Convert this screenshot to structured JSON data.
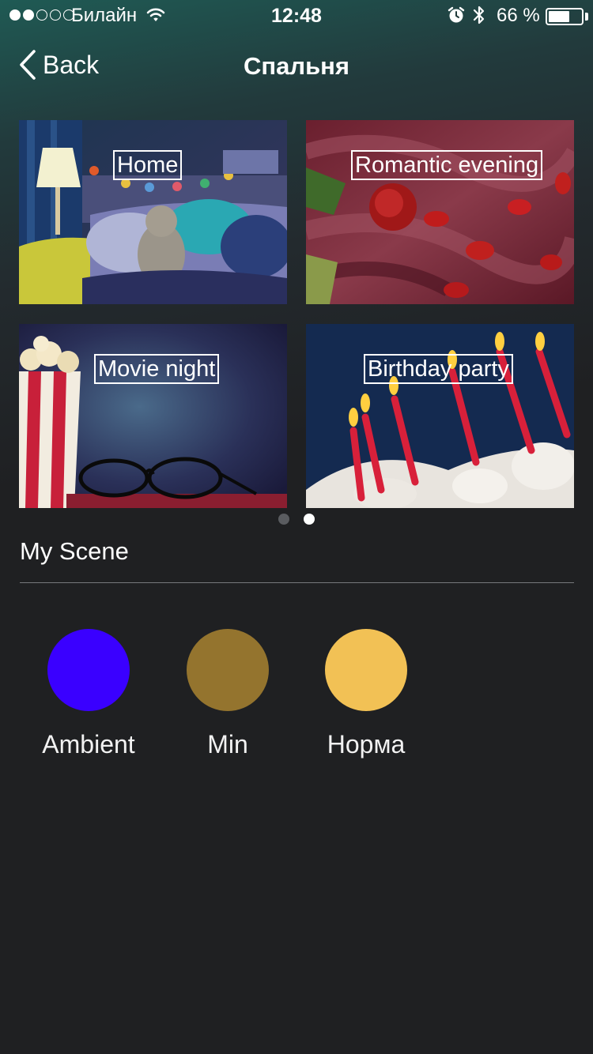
{
  "status_bar": {
    "carrier": "Билайн",
    "time": "12:48",
    "battery_percent": "66 %",
    "battery_level": 0.66,
    "signal_bars_filled": 2,
    "signal_bars_total": 5
  },
  "nav": {
    "back_label": "Back",
    "title": "Спальня"
  },
  "tiles": [
    {
      "label": "Home",
      "image": "kids-bedroom-photo"
    },
    {
      "label": "Romantic evening",
      "image": "rose-petals-silk-photo"
    },
    {
      "label": "Movie night",
      "image": "popcorn-glasses-photo"
    },
    {
      "label": "Birthday party",
      "image": "birthday-candles-photo"
    }
  ],
  "pager": {
    "pages": 2,
    "active_index": 1
  },
  "my_scene": {
    "title": "My Scene",
    "scenes": [
      {
        "label": "Ambient",
        "color": "#3a00ff"
      },
      {
        "label": "Min",
        "color": "#94742e"
      },
      {
        "label": "Норма",
        "color": "#f2c155"
      }
    ]
  }
}
